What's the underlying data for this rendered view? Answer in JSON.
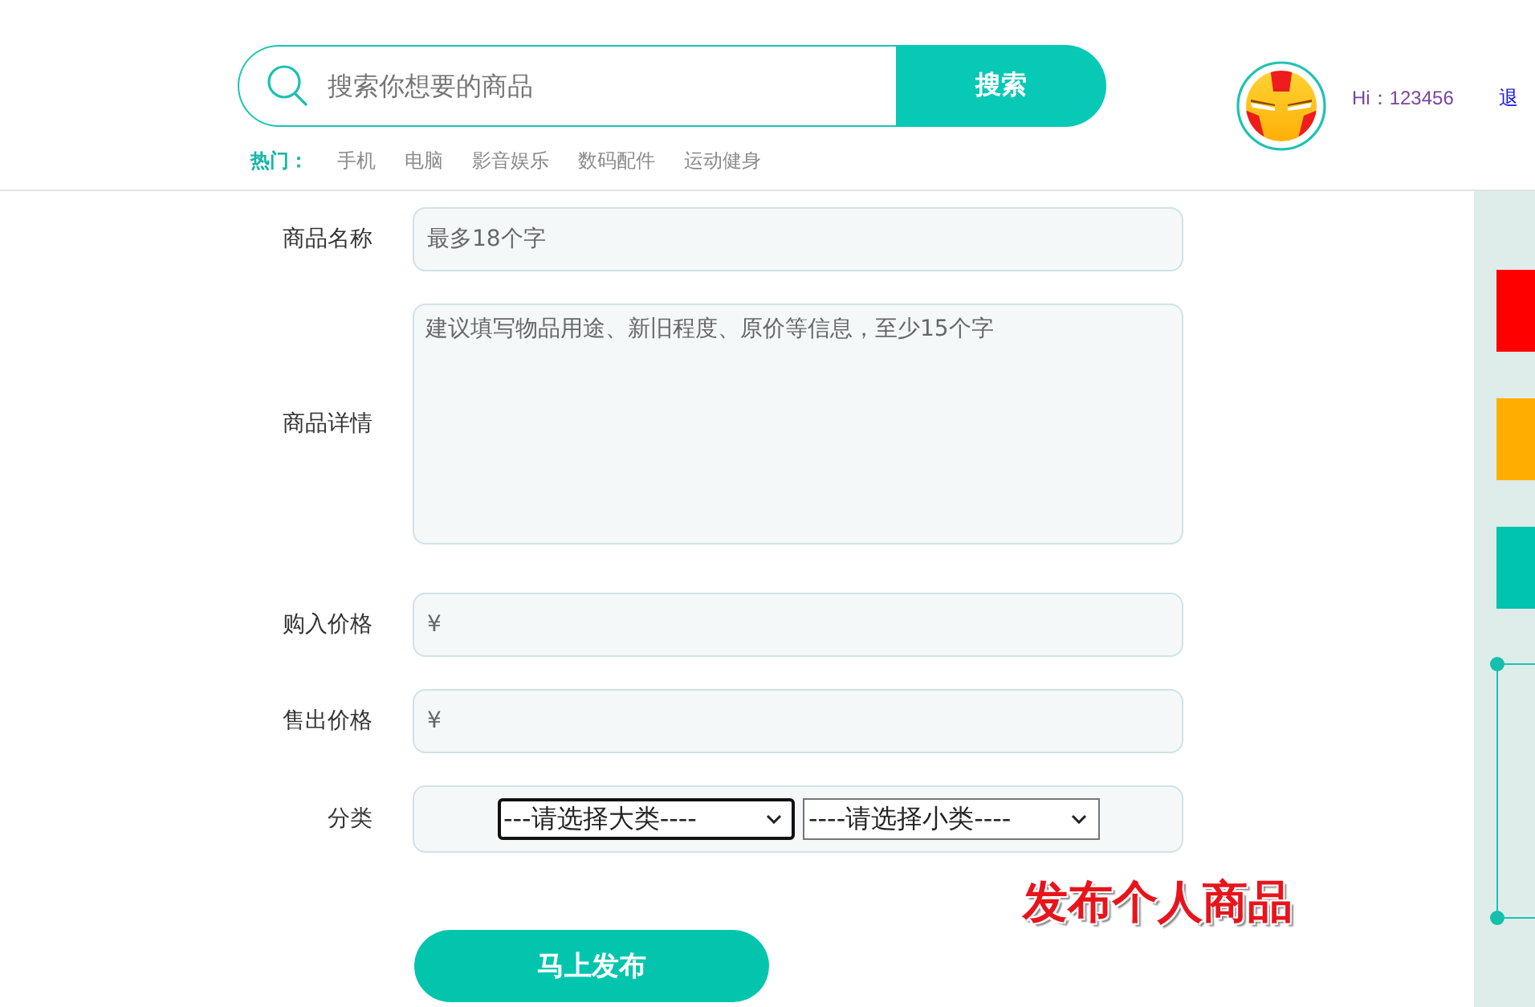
{
  "header": {
    "search": {
      "placeholder": "搜索你想要的商品",
      "button": "搜索"
    },
    "hot": {
      "label": "热门：",
      "links": [
        "手机",
        "电脑",
        "影音娱乐",
        "数码配件",
        "运动健身"
      ]
    },
    "user": {
      "greeting": "Hi：123456",
      "logout": "退"
    }
  },
  "form": {
    "fields": [
      {
        "kind": "input",
        "label": "商品名称",
        "placeholder": "最多18个字"
      },
      {
        "kind": "textarea",
        "label": "商品详情",
        "placeholder": "建议填写物品用途、新旧程度、原价等信息，至少15个字"
      },
      {
        "kind": "input",
        "label": "购入价格",
        "placeholder": "¥"
      },
      {
        "kind": "input",
        "label": "售出价格",
        "placeholder": "¥"
      },
      {
        "kind": "select",
        "label": "分类",
        "selects": [
          {
            "value": "---请选择大类----",
            "focused": true
          },
          {
            "value": "----请选择小类----",
            "focused": false
          }
        ]
      }
    ],
    "caption": "发布个人商品",
    "submit": "马上发布"
  },
  "side_panel": {
    "tiles": [
      {
        "color": "#ff0000"
      },
      {
        "color": "#ffae00"
      },
      {
        "color": "#00c4ad"
      }
    ]
  }
}
